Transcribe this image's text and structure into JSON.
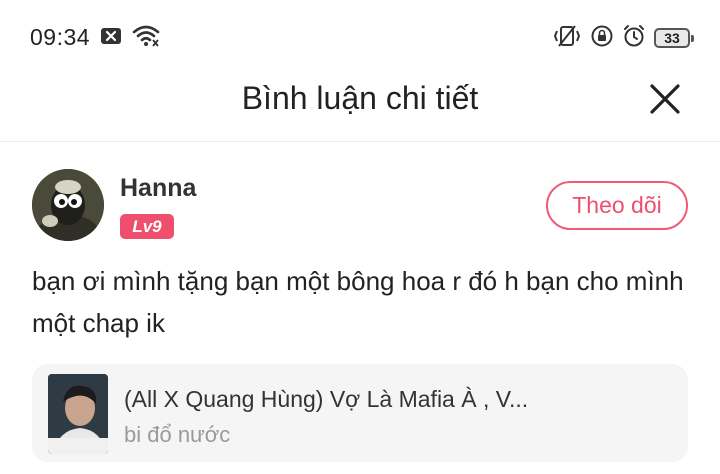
{
  "status_bar": {
    "time": "09:34",
    "battery": "33",
    "icons": [
      "close-box-icon",
      "wifi-icon",
      "vibrate-icon",
      "rotation-lock-icon",
      "alarm-icon",
      "battery-icon"
    ]
  },
  "header": {
    "title": "Bình luận chi tiết",
    "close_icon": "close-icon"
  },
  "comment": {
    "username": "Hanna",
    "level": "Lv9",
    "follow_label": "Theo dõi",
    "text": "bạn ơi mình tặng bạn một bông hoa r đó h bạn cho mình một chap ik"
  },
  "story_card": {
    "title": "(All X Quang Hùng) Vợ Là Mafia À , V...",
    "author": "bi đổ nước"
  },
  "colors": {
    "accent": "#ef4f6d",
    "text_primary": "#222222",
    "text_secondary": "#9a9a9a",
    "card_bg": "#f5f5f5"
  }
}
